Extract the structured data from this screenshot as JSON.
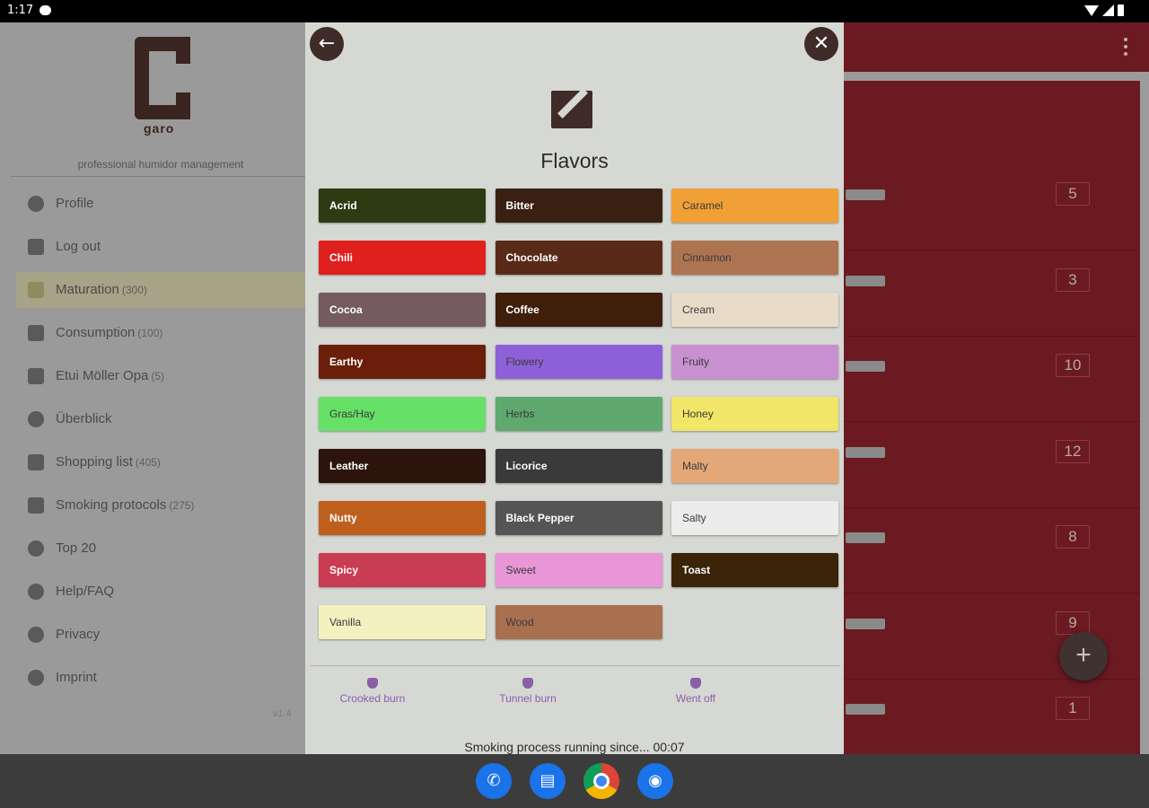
{
  "status_bar": {
    "time": "1:17"
  },
  "drawer": {
    "logo_text": "garo",
    "tagline": "professional humidor management",
    "version": "v1.4",
    "items": [
      {
        "label": "Profile",
        "count": "",
        "icon": "person-icon"
      },
      {
        "label": "Log out",
        "count": "",
        "icon": "logout-icon"
      },
      {
        "label": "Maturation",
        "count": "(300)",
        "icon": "humidor-icon",
        "active": true
      },
      {
        "label": "Consumption",
        "count": "(100)",
        "icon": "humidor-icon"
      },
      {
        "label": "Etui Möller Opa",
        "count": "(5)",
        "icon": "case-icon"
      },
      {
        "label": "Überblick",
        "count": "",
        "icon": "eye-icon"
      },
      {
        "label": "Shopping list",
        "count": "(405)",
        "icon": "cart-icon"
      },
      {
        "label": "Smoking protocols",
        "count": "(275)",
        "icon": "document-icon"
      },
      {
        "label": "Top 20",
        "count": "",
        "icon": "smiley-icon"
      },
      {
        "label": "Help/FAQ",
        "count": "",
        "icon": "help-icon"
      },
      {
        "label": "Privacy",
        "count": "",
        "icon": "info-icon"
      },
      {
        "label": "Imprint",
        "count": "",
        "icon": "info-icon"
      }
    ]
  },
  "dialog": {
    "title": "Flavors",
    "back_icon": "←",
    "close_icon": "✕",
    "flavors": [
      {
        "label": "Acrid",
        "color": "#2c3b12",
        "text": "dark"
      },
      {
        "label": "Bitter",
        "color": "#3a2012",
        "text": "dark"
      },
      {
        "label": "Caramel",
        "color": "#f0a035",
        "text": "light"
      },
      {
        "label": "Chili",
        "color": "#e0201c",
        "text": "dark"
      },
      {
        "label": "Chocolate",
        "color": "#5a2a18",
        "text": "dark"
      },
      {
        "label": "Cinnamon",
        "color": "#ac7450",
        "text": "light"
      },
      {
        "label": "Cocoa",
        "color": "#735b60",
        "text": "dark"
      },
      {
        "label": "Coffee",
        "color": "#3f1e0a",
        "text": "dark"
      },
      {
        "label": "Cream",
        "color": "#e8dcc8",
        "text": "light"
      },
      {
        "label": "Earthy",
        "color": "#6b1f0a",
        "text": "dark"
      },
      {
        "label": "Flowery",
        "color": "#8e60d8",
        "text": "light"
      },
      {
        "label": "Fruity",
        "color": "#c890d0",
        "text": "light"
      },
      {
        "label": "Gras/Hay",
        "color": "#66e066",
        "text": "light"
      },
      {
        "label": "Herbs",
        "color": "#5fa86e",
        "text": "light"
      },
      {
        "label": "Honey",
        "color": "#f2e668",
        "text": "light"
      },
      {
        "label": "Leather",
        "color": "#2c130c",
        "text": "dark"
      },
      {
        "label": "Licorice",
        "color": "#3a3a3a",
        "text": "dark"
      },
      {
        "label": "Malty",
        "color": "#e4a878",
        "text": "light"
      },
      {
        "label": "Nutty",
        "color": "#bf5f1e",
        "text": "dark"
      },
      {
        "label": "Black Pepper",
        "color": "#545454",
        "text": "dark"
      },
      {
        "label": "Salty",
        "color": "#ececec",
        "text": "light"
      },
      {
        "label": "Spicy",
        "color": "#c93c52",
        "text": "dark"
      },
      {
        "label": "Sweet",
        "color": "#e896d8",
        "text": "light"
      },
      {
        "label": "Toast",
        "color": "#3b2408",
        "text": "dark"
      },
      {
        "label": "Vanilla",
        "color": "#f5f0c0",
        "text": "light"
      },
      {
        "label": "Wood",
        "color": "#a8704e",
        "text": "light"
      }
    ],
    "burn_options": [
      "Crooked burn",
      "Tunnel burn",
      "Went off"
    ],
    "smoking_status": "Smoking process running since... 00:07"
  },
  "list": {
    "counts": [
      "5",
      "3",
      "10",
      "12",
      "8",
      "9",
      "1"
    ]
  },
  "fab_label": "+",
  "colors": {
    "accent": "#3f2b27",
    "list_bg": "#6b1a21",
    "burn": "#8b5ea8"
  }
}
